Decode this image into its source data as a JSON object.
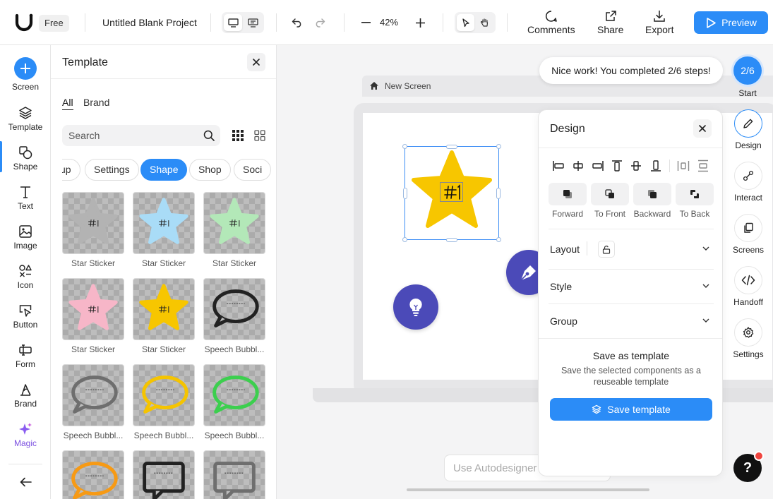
{
  "topbar": {
    "plan": "Free",
    "project_title": "Untitled Blank Project",
    "zoom": "42%",
    "comments": "Comments",
    "share": "Share",
    "export": "Export",
    "preview": "Preview"
  },
  "rail": {
    "items": [
      {
        "label": "Screen",
        "icon": "plus-icon"
      },
      {
        "label": "Template",
        "icon": "layers-icon"
      },
      {
        "label": "Shape",
        "icon": "shapes-icon"
      },
      {
        "label": "Text",
        "icon": "text-icon"
      },
      {
        "label": "Image",
        "icon": "image-icon"
      },
      {
        "label": "Icon",
        "icon": "icons-icon"
      },
      {
        "label": "Button",
        "icon": "cursor-button-icon"
      },
      {
        "label": "Form",
        "icon": "form-icon"
      },
      {
        "label": "Brand",
        "icon": "brand-icon"
      },
      {
        "label": "Magic",
        "icon": "sparkle-icon"
      }
    ],
    "magic_color": "#7b4fe0"
  },
  "template_panel": {
    "title": "Template",
    "tabs": [
      "All",
      "Brand"
    ],
    "search_placeholder": "Search",
    "chips": [
      "up",
      "Settings",
      "Shape",
      "Shop",
      "Soci"
    ],
    "active_chip": "Shape",
    "cards": [
      {
        "label": "Star Sticker",
        "kind": "star",
        "color": "#b3b3b3"
      },
      {
        "label": "Star Sticker",
        "kind": "star",
        "color": "#a9dcf7"
      },
      {
        "label": "Star Sticker",
        "kind": "star",
        "color": "#b3e8b8"
      },
      {
        "label": "Star Sticker",
        "kind": "star",
        "color": "#f7b6c8"
      },
      {
        "label": "Star Sticker",
        "kind": "star",
        "color": "#f7c600"
      },
      {
        "label": "Speech Bubbl...",
        "kind": "bubble",
        "color": "#222222"
      },
      {
        "label": "Speech Bubbl...",
        "kind": "bubble",
        "color": "#6e6e6e"
      },
      {
        "label": "Speech Bubbl...",
        "kind": "bubble",
        "color": "#f5c400"
      },
      {
        "label": "Speech Bubbl...",
        "kind": "bubble",
        "color": "#3ccf4e"
      },
      {
        "label": "",
        "kind": "bubble",
        "color": "#f79a14"
      },
      {
        "label": "",
        "kind": "square-bubble",
        "color": "#222222"
      },
      {
        "label": "",
        "kind": "square-bubble",
        "color": "#6e6e6e"
      }
    ]
  },
  "canvas": {
    "screen_name": "New Screen",
    "toast": "Nice work! You completed 2/6 steps!",
    "steps": "2/6",
    "steps_label": "Start",
    "autodesigner_placeholder": "Use Autodesigner",
    "star_color": "#f7c600"
  },
  "design_panel": {
    "title": "Design",
    "order_buttons": [
      "Forward",
      "To Front",
      "Backward",
      "To Back"
    ],
    "sections": [
      "Layout",
      "Style",
      "Group"
    ],
    "save_title": "Save as template",
    "save_desc": "Save the selected components as a reuseable template",
    "save_button": "Save template"
  },
  "right_rail": {
    "items": [
      "Design",
      "Interact",
      "Screens",
      "Handoff",
      "Settings"
    ]
  },
  "help": "?",
  "colors": {
    "accent": "#2b8cf7",
    "fab": "#4b4ab8"
  }
}
